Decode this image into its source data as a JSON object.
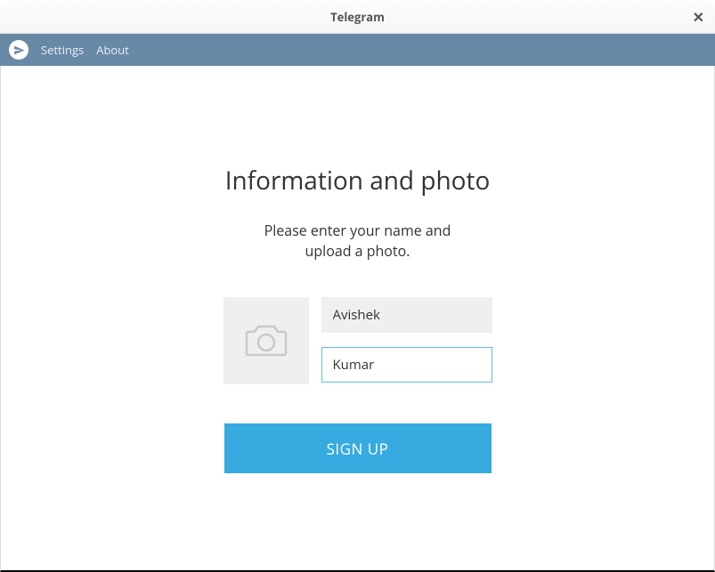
{
  "window": {
    "title": "Telegram"
  },
  "menubar": {
    "settings_label": "Settings",
    "about_label": "About"
  },
  "signup": {
    "heading": "Information and photo",
    "subtitle_line1": "Please enter your name and",
    "subtitle_line2": "upload a photo.",
    "first_name_value": "Avishek",
    "last_name_value": "Kumar",
    "button_label": "SIGN UP"
  },
  "colors": {
    "menubar_bg": "#6889a5",
    "accent": "#37aae0",
    "input_focus_border": "#5fbde4",
    "input_bg": "#efefef"
  }
}
